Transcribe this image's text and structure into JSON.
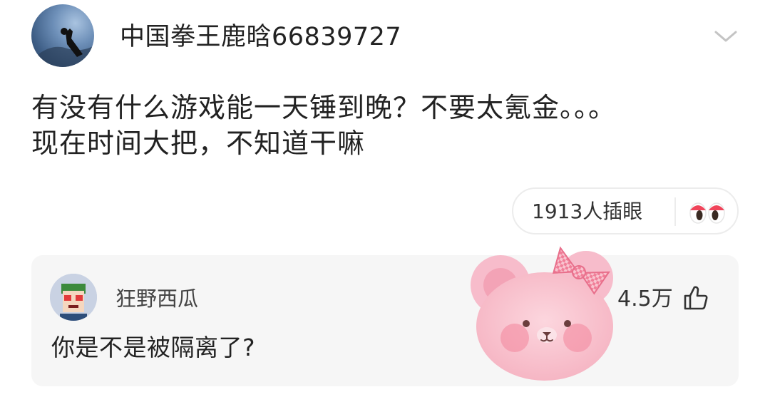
{
  "post": {
    "username": "中国拳王鹿晗66839727",
    "body_lines": [
      "有没有什么游戏能一天锤到晚？不要太氪金。。。",
      "现在时间大把，不知道干嘛"
    ]
  },
  "insert": {
    "count_label": "1913人插眼",
    "icon": "eyes-icon"
  },
  "comment": {
    "username": "狂野西瓜",
    "text": "你是不是被隔离了?",
    "likes": "4.5万",
    "like_icon": "thumb-up-icon"
  },
  "colors": {
    "text_primary": "#222222",
    "comment_bg": "#f6f6f6",
    "pill_border": "#ececec",
    "sticker_pink": "#f9c2cf",
    "eye_red": "#f0445a"
  }
}
